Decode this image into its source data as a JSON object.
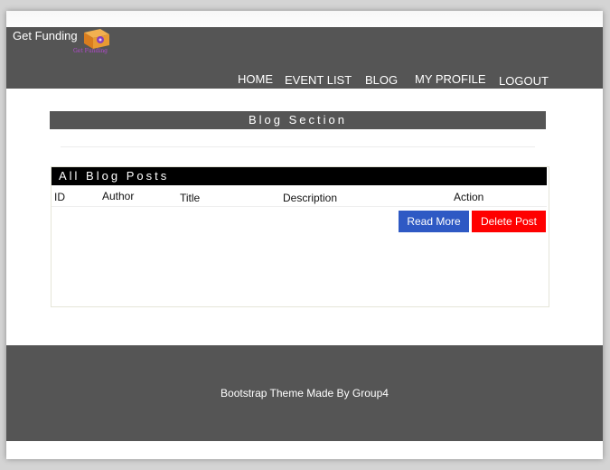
{
  "header": {
    "brand": "Get Funding",
    "logo_tagline": "Get Funding",
    "nav": [
      "HOME",
      "EVENT LIST",
      "BLOG",
      "MY PROFILE",
      "LOGOUT"
    ]
  },
  "main": {
    "section_title": "Blog Section",
    "posts": {
      "title": "All Blog Posts",
      "columns": [
        "ID",
        "Author",
        "Title",
        "Description",
        "Action"
      ],
      "actions": {
        "read_more": "Read More",
        "delete_post": "Delete Post"
      }
    }
  },
  "footer": {
    "text": "Bootstrap Theme Made By Group4"
  },
  "colors": {
    "header_bg": "#555555",
    "read_more_bg": "#2e59c4",
    "delete_bg": "#ff0000",
    "posts_title_bg": "#000000"
  }
}
